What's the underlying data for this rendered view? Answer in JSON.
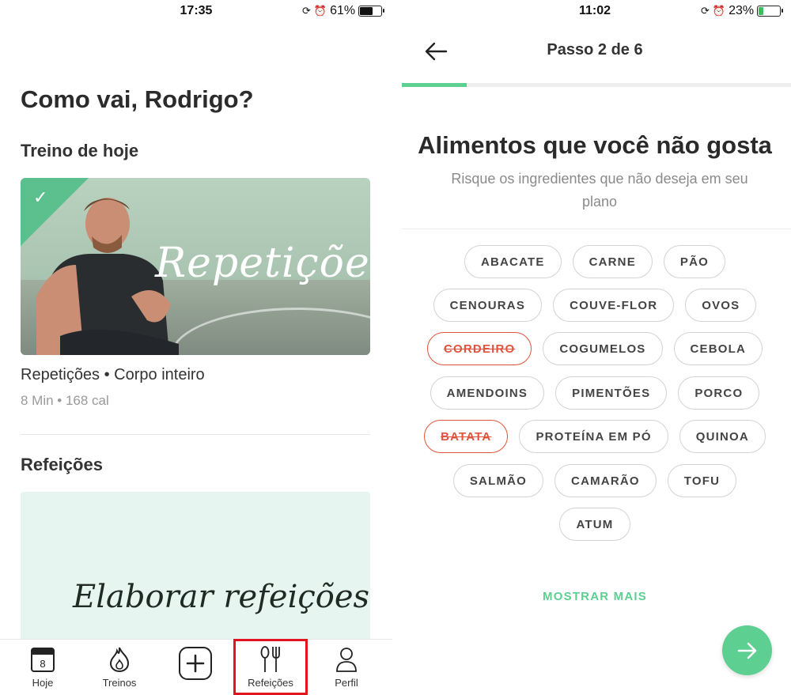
{
  "left": {
    "status": {
      "time": "17:35",
      "battery": "61%",
      "battery_level": 0.61
    },
    "greeting": "Como vai, Rodrigo?",
    "today_section": "Treino de hoje",
    "workout": {
      "card_script": "Repetições",
      "name": "Repetições • Corpo inteiro",
      "meta": "8 Min • 168 cal",
      "completed": true
    },
    "meals_section": "Refeições",
    "meal_card_script": "Elaborar refeições",
    "tabs": [
      {
        "label": "Hoje",
        "icon": "calendar-icon",
        "day": "8"
      },
      {
        "label": "Treinos",
        "icon": "flame-icon"
      },
      {
        "label": "",
        "icon": "plus-icon"
      },
      {
        "label": "Refeições",
        "icon": "cutlery-icon",
        "highlighted": true
      },
      {
        "label": "Perfil",
        "icon": "user-icon"
      }
    ],
    "highlight_color": "#e2141f"
  },
  "right": {
    "status": {
      "time": "11:02",
      "battery": "23%",
      "battery_level": 0.23,
      "charging": true
    },
    "step": "Passo 2 de 6",
    "progress": 0.167,
    "title": "Alimentos que você não gosta",
    "subtitle": "Risque os ingredientes que não deseja em seu plano",
    "chips": [
      [
        "ABACATE",
        "CARNE",
        "PÃO"
      ],
      [
        "CENOURAS",
        "COUVE-FLOR",
        "OVOS"
      ],
      [
        "CORDEIRO",
        "COGUMELOS",
        "CEBOLA"
      ],
      [
        "AMENDOINS",
        "PIMENTÕES",
        "PORCO"
      ],
      [
        "BATATA",
        "PROTEÍNA EM PÓ",
        "QUINOA"
      ],
      [
        "SALMÃO",
        "CAMARÃO",
        "TOFU"
      ],
      [
        "ATUM"
      ]
    ],
    "crossed_out": [
      "CORDEIRO",
      "BATATA"
    ],
    "show_more": "MOSTRAR MAIS",
    "accent": "#5ccf91",
    "crossed_color": "#e0533d"
  }
}
